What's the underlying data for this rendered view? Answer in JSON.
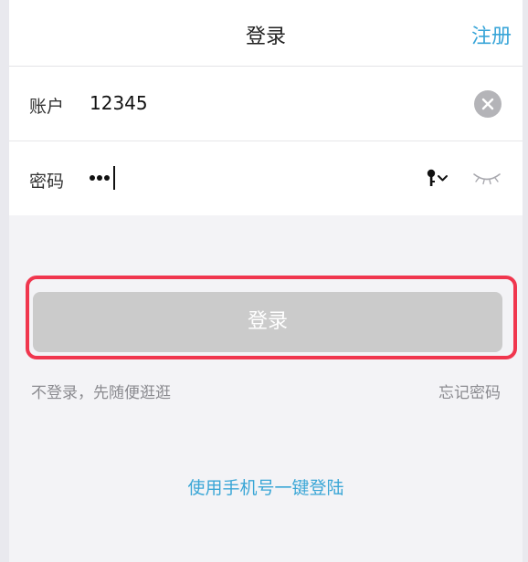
{
  "navbar": {
    "title": "登录",
    "right_action": "注册"
  },
  "form": {
    "account": {
      "label": "账户",
      "value": "12345"
    },
    "password": {
      "label": "密码",
      "masked_value": "•••"
    }
  },
  "login_button": {
    "label": "登录"
  },
  "links": {
    "guest": "不登录，先随便逛逛",
    "forgot": "忘记密码",
    "phone_login": "使用手机号一键登陆"
  },
  "icons": {
    "clear": "clear-icon",
    "key": "key-icon",
    "chevron": "chevron-down-icon",
    "eye": "eye-closed-icon"
  },
  "colors": {
    "accent": "#38a5d8",
    "highlight_border": "#f0364e",
    "disabled_button": "#cbcbcb"
  }
}
